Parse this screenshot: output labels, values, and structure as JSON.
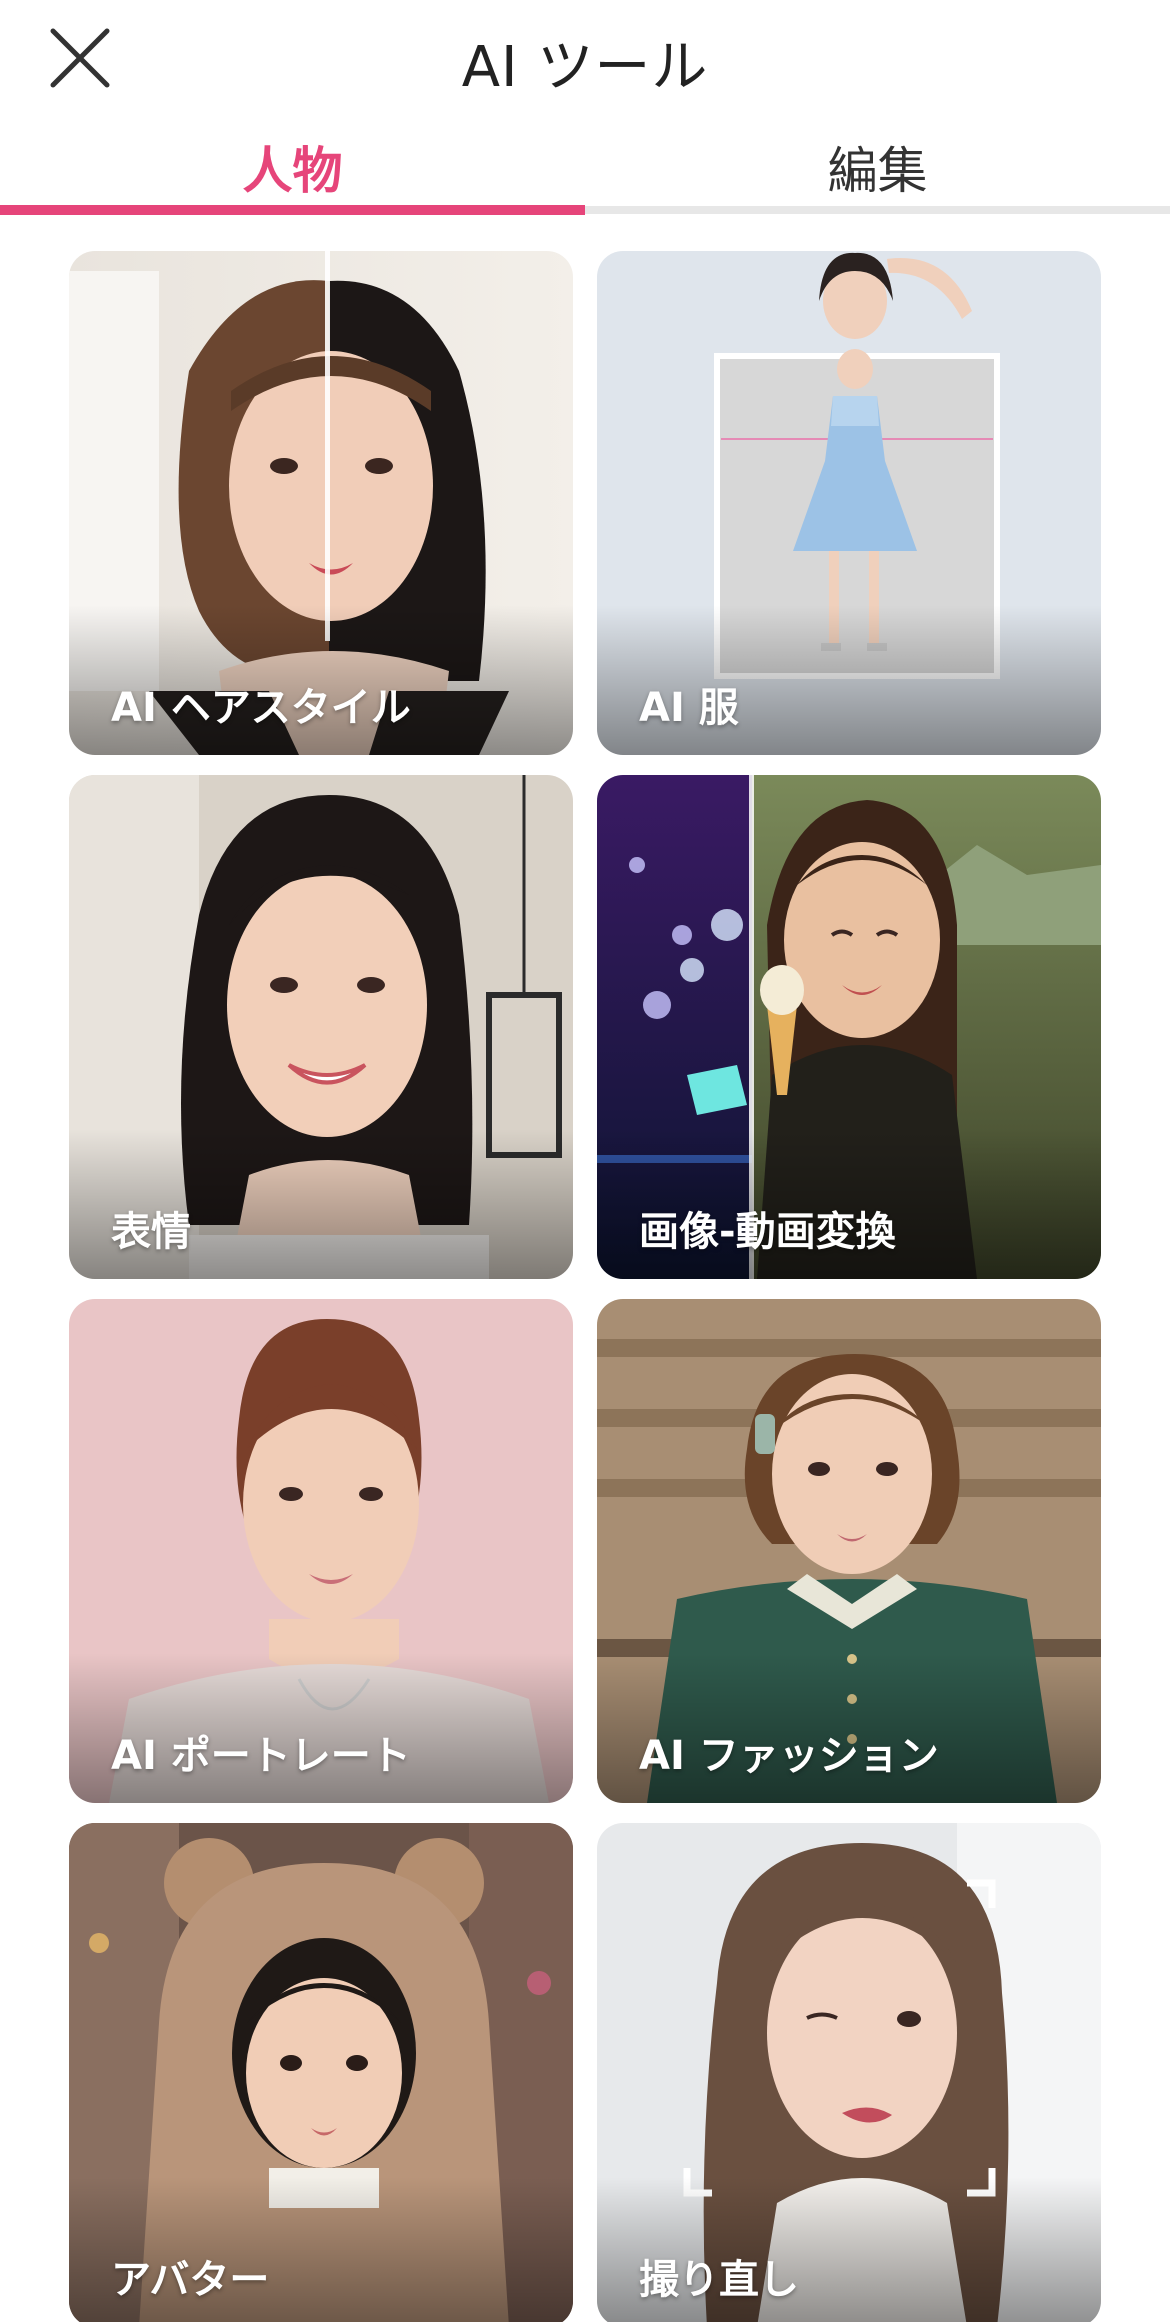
{
  "header": {
    "title": "AI ツール",
    "close_icon": "close-icon"
  },
  "tabs": [
    {
      "label": "人物",
      "active": true
    },
    {
      "label": "編集",
      "active": false
    }
  ],
  "colors": {
    "accent": "#e6457a",
    "tab_inactive_text": "#333333",
    "underline_bg": "#e7e7e7"
  },
  "tools": [
    {
      "label": "AI ヘアスタイル"
    },
    {
      "label": "AI 服"
    },
    {
      "label": "表情"
    },
    {
      "label": "画像-動画変換"
    },
    {
      "label": "AI ポートレート"
    },
    {
      "label": "AI ファッション"
    },
    {
      "label": "アバター"
    },
    {
      "label": "撮り直し"
    }
  ]
}
